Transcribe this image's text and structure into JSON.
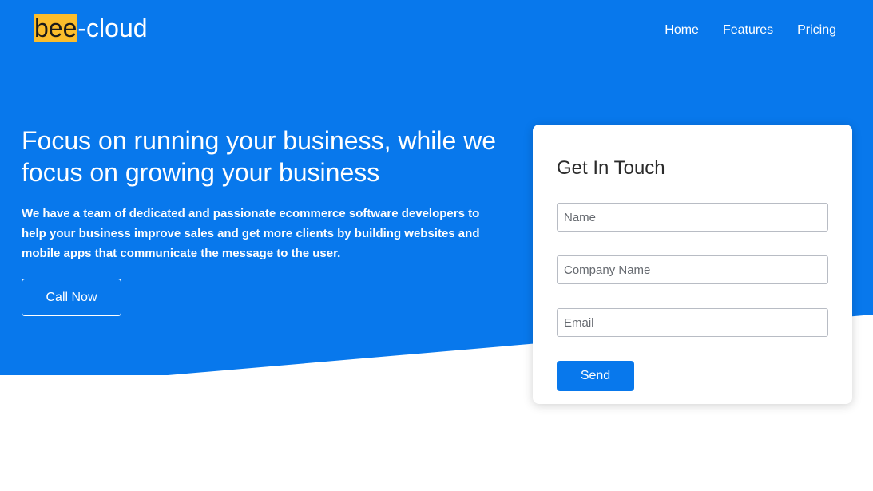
{
  "brand": {
    "logo_highlight": "bee",
    "logo_rest": "-cloud",
    "primary_color": "#0878ec",
    "highlight_color": "#fbbd2c"
  },
  "nav": {
    "items": [
      {
        "label": "Home"
      },
      {
        "label": "Features"
      },
      {
        "label": "Pricing"
      }
    ]
  },
  "hero": {
    "headline": "Focus on running your business, while we focus on growing your business",
    "subtext": "We have a team of dedicated and passionate ecommerce software developers to help your business improve sales and get more clients by building websites and mobile apps that communicate the message to the user.",
    "cta_label": "Call Now"
  },
  "contact": {
    "title": "Get In Touch",
    "name_placeholder": "Name",
    "company_placeholder": "Company Name",
    "email_placeholder": "Email",
    "submit_label": "Send"
  }
}
